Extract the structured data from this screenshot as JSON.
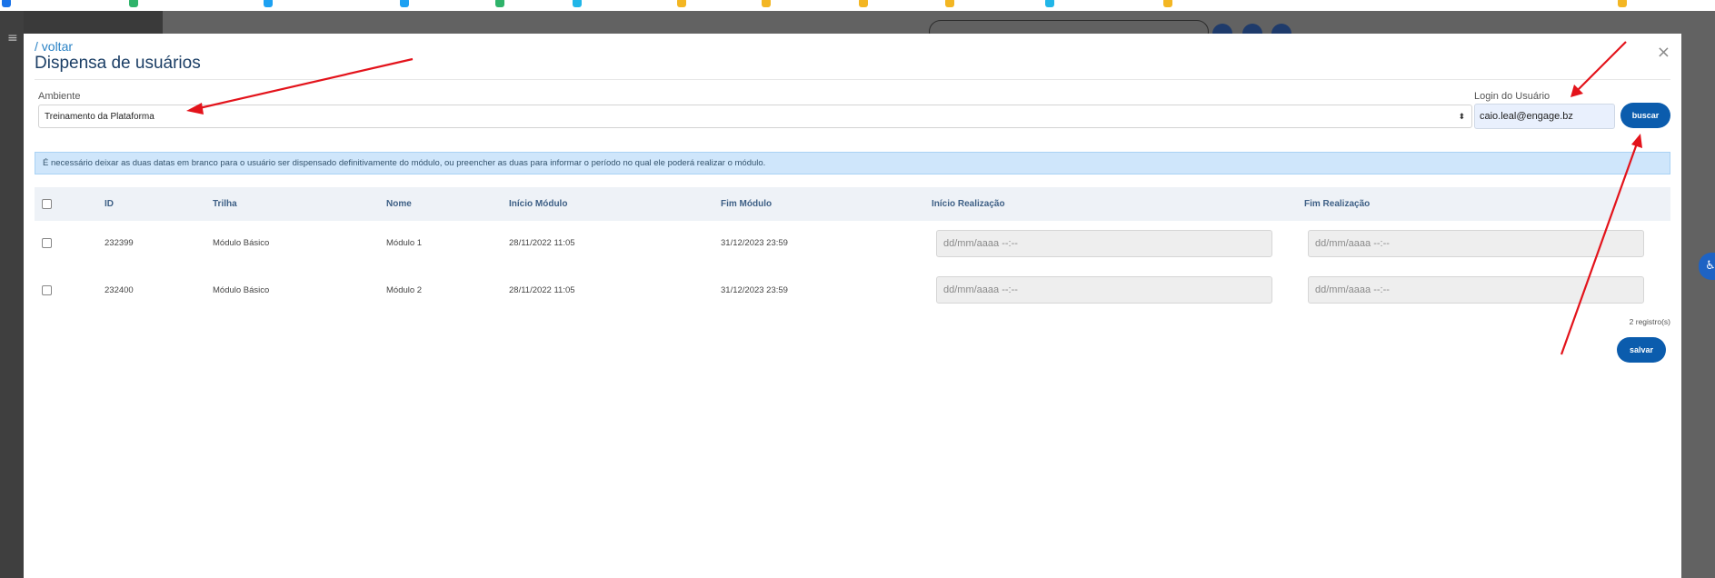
{
  "modal": {
    "back_label": "/ voltar",
    "title": "Dispensa de usuários",
    "close_icon": "×"
  },
  "form": {
    "ambiente_label": "Ambiente",
    "ambiente_value": "Treinamento da Plataforma",
    "login_label": "Login do Usuário",
    "login_value": "caio.leal@engage.bz",
    "buscar_label": "buscar"
  },
  "info_text": "É necessário deixar as duas datas em branco para o usuário ser dispensado definitivamente do módulo, ou preencher as duas para informar o período no qual ele poderá realizar o módulo.",
  "table": {
    "headers": [
      "ID",
      "Trilha",
      "Nome",
      "Início Módulo",
      "Fim Módulo",
      "Início Realização",
      "Fim Realização"
    ],
    "rows": [
      {
        "id": "232399",
        "trilha": "Módulo Básico",
        "nome": "Módulo 1",
        "inicio": "28/11/2022 11:05",
        "fim": "31/12/2023 23:59",
        "inicio_real_placeholder": "dd/mm/aaaa --:--",
        "fim_real_placeholder": "dd/mm/aaaa --:--"
      },
      {
        "id": "232400",
        "trilha": "Módulo Básico",
        "nome": "Módulo 2",
        "inicio": "28/11/2022 11:05",
        "fim": "31/12/2023 23:59",
        "inicio_real_placeholder": "dd/mm/aaaa --:--",
        "fim_real_placeholder": "dd/mm/aaaa --:--"
      }
    ],
    "record_count": "2 registro(s)"
  },
  "save_label": "salvar",
  "colors": {
    "primary": "#0b5cad",
    "link": "#2b83c6",
    "info_bg": "#cfe6fb",
    "annotation": "#e3131b",
    "header_bg": "#eef2f7"
  }
}
